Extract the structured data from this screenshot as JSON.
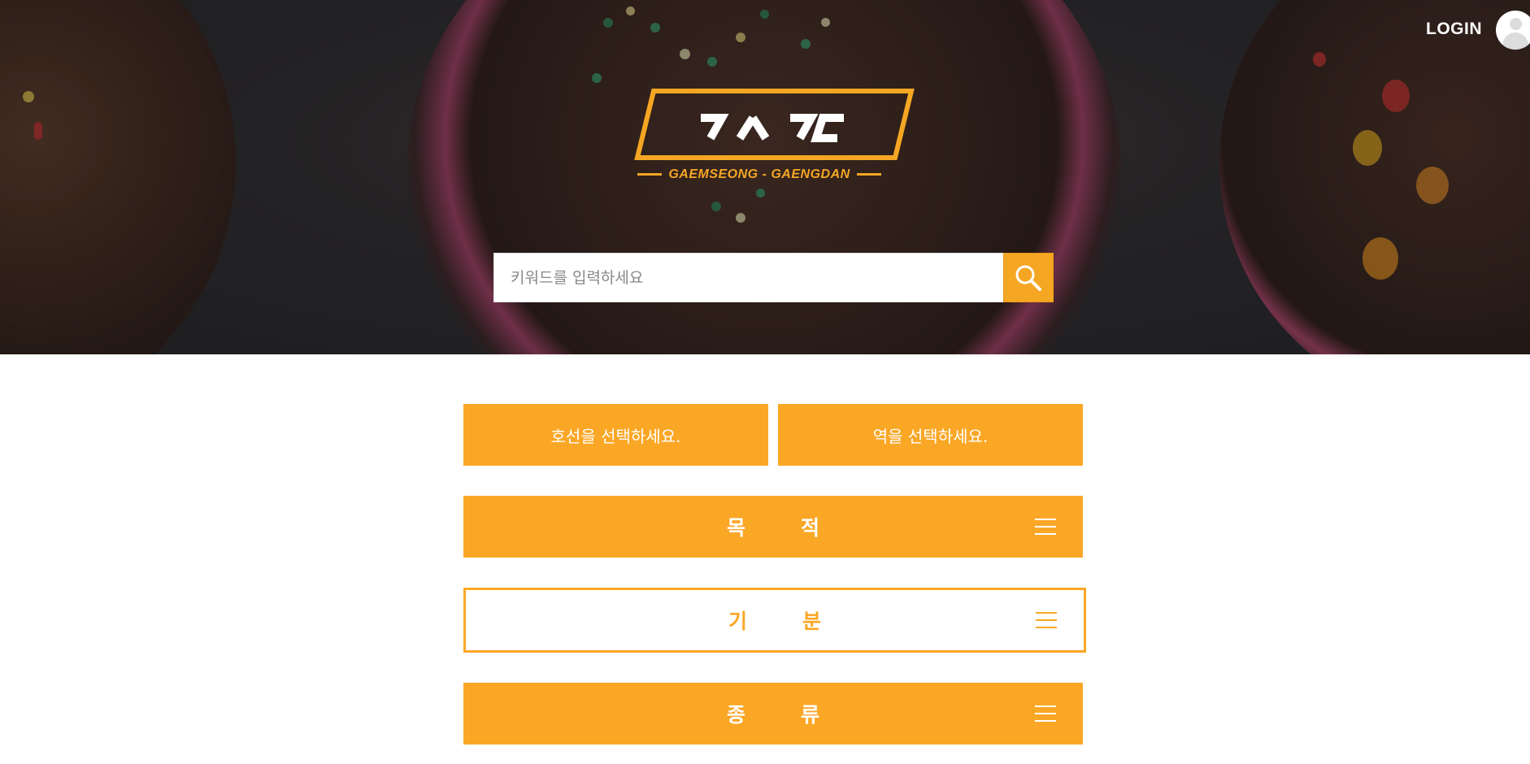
{
  "header": {
    "login_label": "LOGIN",
    "logo_subtitle": "GAEMSEONG - GAENGDAN",
    "brand_color": "#fba726"
  },
  "search": {
    "placeholder": "키워드를 입력하세요",
    "button_icon": "search-icon"
  },
  "filters": {
    "line_select_label": "호선을 선택하세요.",
    "station_select_label": "역을 선택하세요."
  },
  "categories": [
    {
      "label": "목적",
      "style": "filled",
      "icon": "menu-icon"
    },
    {
      "label": "기분",
      "style": "outline",
      "icon": "menu-icon"
    },
    {
      "label": "종류",
      "style": "filled",
      "icon": "menu-icon"
    }
  ]
}
